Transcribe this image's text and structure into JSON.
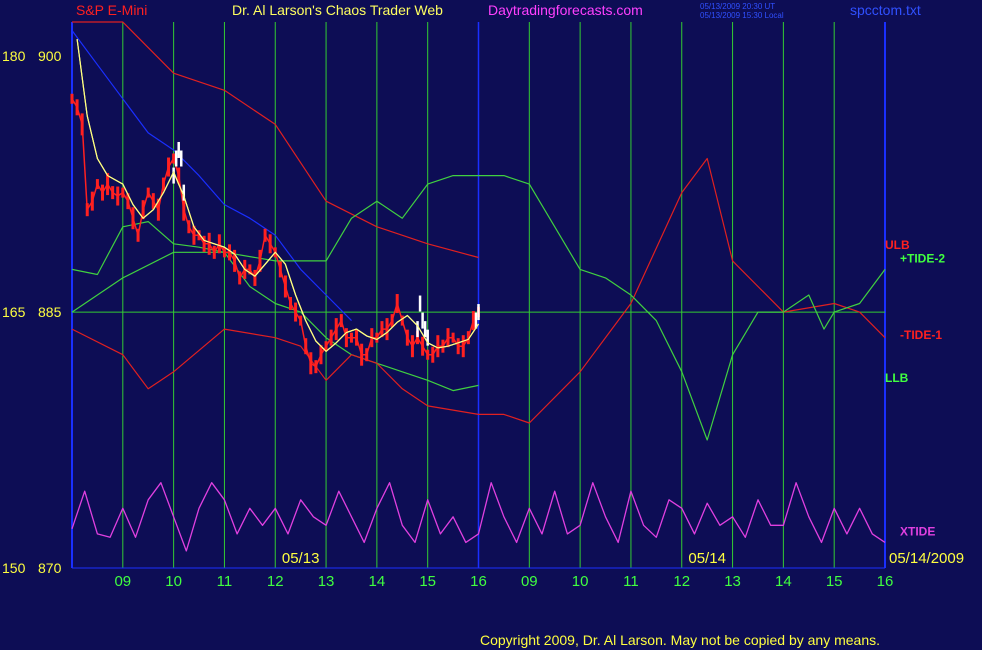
{
  "header": {
    "instrument": "S&P E-Mini",
    "title": "Dr. Al Larson's Chaos Trader Web",
    "site": "Daytradingforecasts.com",
    "stamp_ut": "05/13/2009 20:30 UT",
    "stamp_local": "05/13/2009 15:30 Local",
    "filename": "spcctom.txt"
  },
  "footer": {
    "copyright": "Copyright 2009, Dr. Al Larson. May not be copied by any means."
  },
  "chart_data": {
    "type": "line",
    "y_axis": {
      "ticks": [
        {
          "left": "180",
          "right": "900",
          "price": 900
        },
        {
          "left": "165",
          "right": "885",
          "price": 885
        },
        {
          "left": "150",
          "right": "870",
          "price": 870
        }
      ],
      "range": [
        870,
        902
      ]
    },
    "x_axis": {
      "range": [
        0,
        16
      ],
      "hour_ticks": [
        {
          "x": 1,
          "label": "09"
        },
        {
          "x": 2,
          "label": "10"
        },
        {
          "x": 3,
          "label": "11"
        },
        {
          "x": 4,
          "label": "12"
        },
        {
          "x": 5,
          "label": "13"
        },
        {
          "x": 6,
          "label": "14"
        },
        {
          "x": 7,
          "label": "15"
        },
        {
          "x": 8,
          "label": "16"
        },
        {
          "x": 9,
          "label": "09"
        },
        {
          "x": 10,
          "label": "10"
        },
        {
          "x": 11,
          "label": "11"
        },
        {
          "x": 12,
          "label": "12"
        },
        {
          "x": 13,
          "label": "13"
        },
        {
          "x": 14,
          "label": "14"
        },
        {
          "x": 15,
          "label": "15"
        },
        {
          "x": 16,
          "label": "16"
        }
      ],
      "day_labels": [
        {
          "x": 4.5,
          "label": "05/13"
        },
        {
          "x": 12.5,
          "label": "05/14"
        },
        {
          "x": 16,
          "label": "05/14/2009"
        }
      ]
    },
    "reference_line": {
      "price": 885
    },
    "colors": {
      "price_up": "#ff2020",
      "price_new": "#ffffff",
      "avg": "#ffff80",
      "blue": "#1a2fff",
      "red": "#e02020",
      "green": "#40d040",
      "xtide": "#e040e0",
      "grid": "#33cc33",
      "axis_text": "#40ff40"
    },
    "series": [
      {
        "name": "ULB",
        "color": "#e02020",
        "x": [
          0,
          1,
          2,
          3,
          4,
          5,
          6,
          7,
          8
        ],
        "y": [
          904,
          903,
          899,
          898,
          896,
          891.5,
          890,
          889,
          888.2
        ]
      },
      {
        "name": "LLB",
        "color": "#40d040",
        "x": [
          0,
          0.5,
          1,
          1.5,
          2,
          2.5,
          3,
          3.5,
          4,
          4.5,
          5,
          5.5,
          6,
          6.5,
          7,
          7.5,
          8
        ],
        "y": [
          887.5,
          887.2,
          890,
          890.3,
          889,
          888.8,
          888.5,
          886.5,
          885.5,
          885,
          883.5,
          882.5,
          882,
          881.5,
          881,
          880.4,
          880.7
        ]
      },
      {
        "name": "blue_line",
        "color": "#1a2fff",
        "x": [
          0,
          0.5,
          1,
          1.5,
          2,
          2.5,
          3,
          3.5,
          4,
          4.5,
          5,
          5.5
        ],
        "y": [
          901.5,
          899.5,
          897.5,
          895.5,
          894.5,
          893,
          891.3,
          890.5,
          889.5,
          887.5,
          886,
          884.5
        ]
      },
      {
        "name": "-TIDE-1",
        "color": "#e02020",
        "x": [
          0,
          1,
          1.5,
          2,
          3,
          4,
          4.5,
          5,
          5.5,
          6,
          6.5,
          7,
          8,
          8.5,
          9,
          10,
          11,
          12,
          12.5,
          13,
          14,
          15,
          15.5,
          16
        ],
        "y": [
          884,
          882.5,
          880.5,
          881.5,
          884,
          883.5,
          883,
          881,
          882.5,
          882,
          880.5,
          879.5,
          879,
          879,
          878.5,
          881.5,
          885.5,
          892,
          894,
          888,
          885,
          885.5,
          885,
          883.5
        ]
      },
      {
        "name": "+TIDE-2",
        "color": "#40d040",
        "x": [
          0,
          1,
          2,
          3,
          4,
          5,
          5.5,
          6,
          6.5,
          7,
          7.5,
          8,
          8.5,
          9,
          10,
          10.5,
          11,
          11.5,
          12,
          12.5,
          13,
          13.5,
          14,
          14.5,
          14.8,
          15,
          15.5,
          16
        ],
        "y": [
          885,
          887,
          888.5,
          888.5,
          888,
          888,
          890.5,
          891.5,
          890.5,
          892.5,
          893,
          893,
          893,
          892.5,
          887.5,
          887,
          886,
          884.5,
          881.5,
          877.5,
          882.5,
          885,
          885,
          886,
          884,
          885,
          885.5,
          887.5
        ]
      },
      {
        "name": "XTIDE",
        "color": "#e040e0",
        "x": [
          0,
          0.25,
          0.5,
          0.75,
          1,
          1.25,
          1.5,
          1.75,
          2,
          2.25,
          2.5,
          2.75,
          3,
          3.25,
          3.5,
          3.75,
          4,
          4.25,
          4.5,
          4.75,
          5,
          5.25,
          5.5,
          5.75,
          6,
          6.25,
          6.5,
          6.75,
          7,
          7.25,
          7.5,
          7.75,
          8,
          8.25,
          8.5,
          8.75,
          9,
          9.25,
          9.5,
          9.75,
          10,
          10.25,
          10.5,
          10.75,
          11,
          11.25,
          11.5,
          11.75,
          12,
          12.25,
          12.5,
          12.75,
          13,
          13.25,
          13.5,
          13.75,
          14,
          14.25,
          14.5,
          14.75,
          15,
          15.25,
          15.5,
          15.75,
          16
        ],
        "y": [
          872.3,
          874.5,
          872,
          871.8,
          873.5,
          871.8,
          874,
          875,
          873,
          871,
          873.5,
          875,
          874,
          872,
          873.5,
          872.5,
          873.5,
          872,
          874,
          873,
          872.5,
          874.5,
          873,
          871.5,
          873.5,
          875,
          872.5,
          871.5,
          874,
          872,
          873,
          871.5,
          872,
          875,
          873,
          871.5,
          873.5,
          872,
          874.5,
          872,
          872.5,
          875,
          873,
          871.5,
          874.5,
          872.5,
          871.8,
          874,
          873.5,
          872,
          873.8,
          872.5,
          873,
          871.8,
          874,
          872.5,
          872.5,
          875,
          873,
          871.5,
          873.5,
          872,
          873.5,
          872,
          871.5
        ]
      },
      {
        "name": "price",
        "color": "#ff2020",
        "x": [
          0,
          0.1,
          0.2,
          0.3,
          0.4,
          0.5,
          0.6,
          0.7,
          0.8,
          0.9,
          1,
          1.1,
          1.2,
          1.3,
          1.4,
          1.5,
          1.6,
          1.7,
          1.8,
          1.9,
          2,
          2.1,
          2.2,
          2.3,
          2.4,
          2.5,
          2.6,
          2.7,
          2.8,
          2.9,
          3,
          3.1,
          3.2,
          3.3,
          3.4,
          3.5,
          3.6,
          3.7,
          3.8,
          3.9,
          4,
          4.1,
          4.2,
          4.3,
          4.4,
          4.5,
          4.6,
          4.7,
          4.8,
          4.9,
          5,
          5.1,
          5.2,
          5.3,
          5.4,
          5.5,
          5.6,
          5.7,
          5.8,
          5.9,
          6,
          6.1,
          6.2,
          6.3,
          6.4,
          6.5,
          6.6,
          6.7,
          6.8,
          6.9,
          7,
          7.1,
          7.2,
          7.3,
          7.4,
          7.5,
          7.6,
          7.7,
          7.8,
          7.9,
          8
        ],
        "y": [
          897.5,
          897,
          896,
          891,
          891.5,
          892.5,
          892,
          892.5,
          892,
          891.8,
          892,
          891.5,
          890.5,
          889.5,
          891,
          892,
          891.5,
          891,
          892.5,
          893.5,
          894,
          893,
          891,
          890,
          889.5,
          889.5,
          889,
          889,
          888.5,
          889,
          888.5,
          888.5,
          888,
          887,
          887.5,
          887.5,
          887,
          888,
          889.5,
          889,
          888.5,
          887.5,
          886.5,
          885.5,
          885,
          884.5,
          883,
          882,
          881.8,
          882.5,
          883,
          883.5,
          884,
          884.5,
          883.5,
          883.5,
          883.5,
          882.5,
          882.5,
          883.5,
          883.5,
          884,
          884,
          884.5,
          885.5,
          884.5,
          883.5,
          883,
          883.5,
          883,
          882.5,
          882.5,
          883,
          883,
          883.5,
          883.5,
          883,
          883,
          883.5,
          884.5,
          885
        ]
      },
      {
        "name": "average",
        "color": "#ffff80",
        "x": [
          0.1,
          0.3,
          0.5,
          0.7,
          1,
          1.2,
          1.4,
          1.6,
          1.8,
          2,
          2.2,
          2.4,
          2.6,
          2.8,
          3,
          3.2,
          3.4,
          3.6,
          3.8,
          4,
          4.2,
          4.4,
          4.6,
          4.8,
          5,
          5.2,
          5.4,
          5.6,
          5.8,
          6,
          6.2,
          6.4,
          6.6,
          6.8,
          7,
          7.2,
          7.4,
          7.6,
          7.8,
          8
        ],
        "y": [
          901,
          896.5,
          894,
          893,
          892.5,
          891.3,
          890.5,
          891,
          892,
          893.2,
          891.8,
          890,
          889.2,
          889,
          888.8,
          888.4,
          887.5,
          887.1,
          887.8,
          888.5,
          887.8,
          886,
          884.5,
          883.3,
          882.7,
          883.2,
          883.8,
          884,
          883.6,
          883.4,
          883.8,
          884.4,
          884.8,
          884.2,
          883.2,
          882.9,
          883,
          883.2,
          883.4,
          884.3
        ]
      }
    ],
    "price_highlight": {
      "color": "#ffffff",
      "x": [
        2,
        2.05,
        2.1,
        2.15,
        2.2,
        6.8,
        6.85,
        6.9,
        6.95,
        7,
        7.95,
        8
      ],
      "y": [
        893,
        894,
        894.5,
        894,
        892,
        884,
        885.5,
        884.5,
        884,
        883.5,
        884.5,
        885
      ]
    },
    "series_labels": [
      {
        "text": "ULB",
        "color": "#ff2020",
        "x": 16,
        "y": 889
      },
      {
        "text": "+TIDE-2",
        "color": "#40ff40",
        "x": 16.3,
        "y": 888.2
      },
      {
        "text": "-TIDE-1",
        "color": "#ff2020",
        "x": 16.3,
        "y": 883.7
      },
      {
        "text": "LLB",
        "color": "#40ff40",
        "x": 16,
        "y": 881.2
      },
      {
        "text": "XTIDE",
        "color": "#e040e0",
        "x": 16.4,
        "y": 872.2
      }
    ]
  }
}
